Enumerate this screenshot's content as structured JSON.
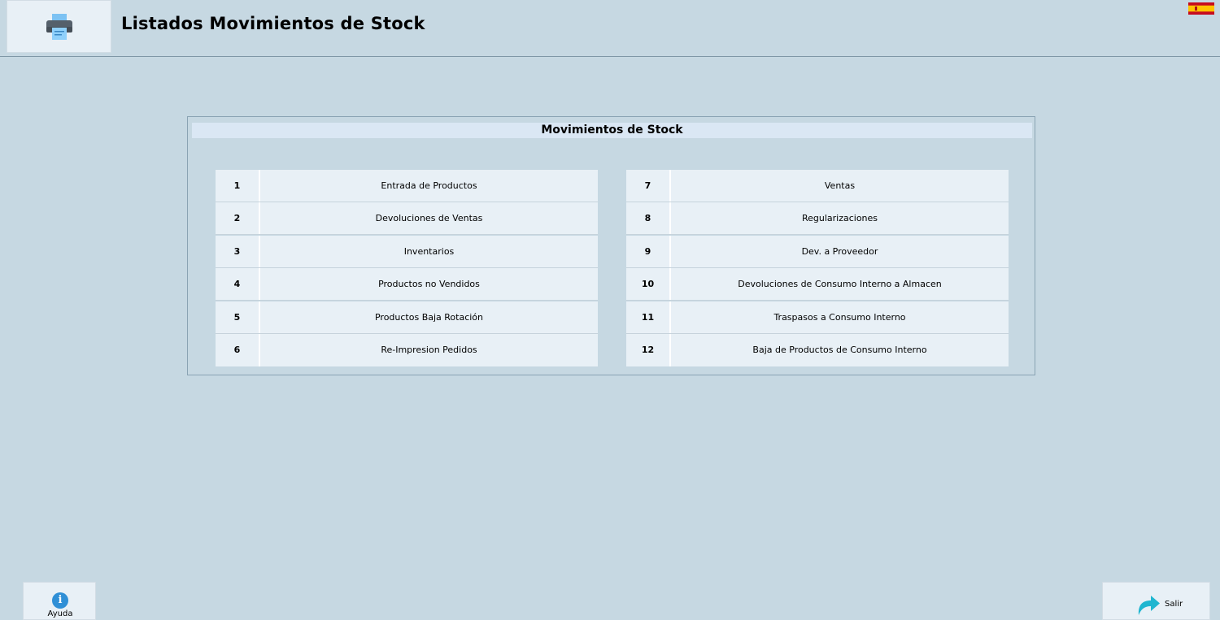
{
  "header": {
    "title": "Listados Movimientos de Stock",
    "icon": "printer-icon",
    "language_flag": "spain-flag-icon"
  },
  "panel": {
    "title": "Movimientos de Stock",
    "left_items": [
      {
        "num": "1",
        "label": "Entrada de Productos"
      },
      {
        "num": "2",
        "label": "Devoluciones de Ventas"
      },
      {
        "num": "3",
        "label": "Inventarios"
      },
      {
        "num": "4",
        "label": "Productos no Vendidos"
      },
      {
        "num": "5",
        "label": "Productos Baja Rotación"
      },
      {
        "num": "6",
        "label": "Re-Impresion Pedidos"
      }
    ],
    "right_items": [
      {
        "num": "7",
        "label": "Ventas"
      },
      {
        "num": "8",
        "label": "Regularizaciones"
      },
      {
        "num": "9",
        "label": "Dev. a Proveedor"
      },
      {
        "num": "10",
        "label": "Devoluciones de Consumo Interno a Almacen"
      },
      {
        "num": "11",
        "label": "Traspasos a Consumo Interno"
      },
      {
        "num": "12",
        "label": "Baja de Productos de Consumo Interno"
      }
    ]
  },
  "footer": {
    "help_label": "Ayuda",
    "help_icon_glyph": "i",
    "exit_label": "Salir"
  },
  "colors": {
    "background": "#c6d8e2",
    "button_bg": "#e8f0f6",
    "panel_title_bg": "#dae7f4",
    "help_icon": "#2f8fd6",
    "exit_icon": "#1fb6d0"
  }
}
